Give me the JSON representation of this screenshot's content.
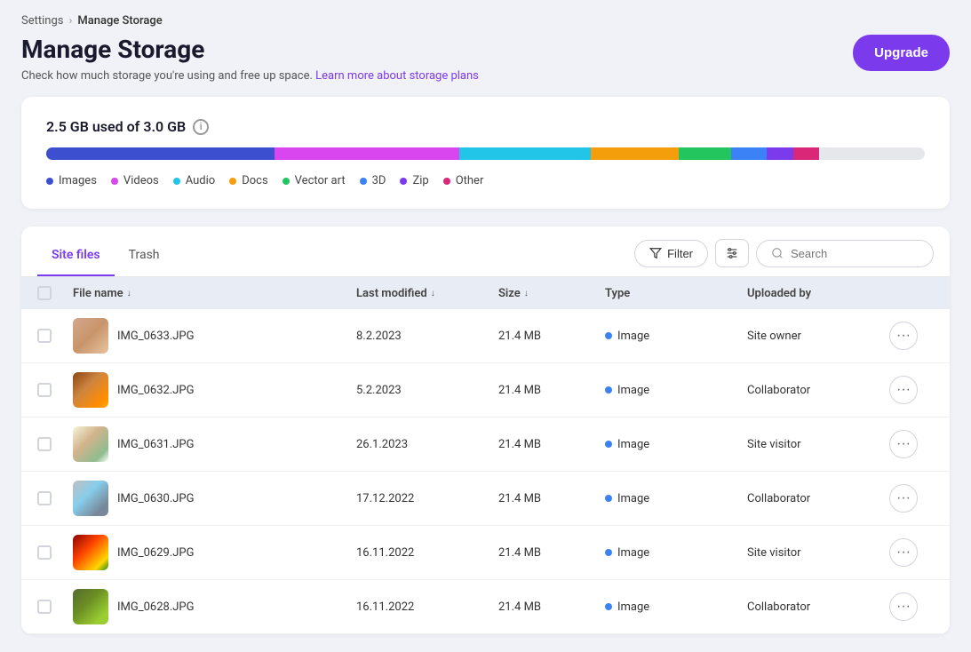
{
  "breadcrumb": {
    "parent": "Settings",
    "current": "Manage Storage"
  },
  "header": {
    "title": "Manage Storage",
    "subtitle": "Check how much storage you're using and free up space.",
    "link_text": "Learn more about storage plans",
    "upgrade_label": "Upgrade"
  },
  "storage": {
    "used_label": "2.5 GB used of 3.0 GB",
    "segments": [
      {
        "label": "Images",
        "color": "#3b4fcf",
        "width": "26%"
      },
      {
        "label": "Videos",
        "color": "#d946ef",
        "width": "21%"
      },
      {
        "label": "Audio",
        "color": "#22c4e8",
        "width": "15%"
      },
      {
        "label": "Docs",
        "color": "#f59e0b",
        "width": "10%"
      },
      {
        "label": "Vector art",
        "color": "#22c55e",
        "width": "6%"
      },
      {
        "label": "3D",
        "color": "#3b82f6",
        "width": "4%"
      },
      {
        "label": "Zip",
        "color": "#7c3aed",
        "width": "3%"
      },
      {
        "label": "Other",
        "color": "#db2777",
        "width": "3%"
      }
    ]
  },
  "tabs": [
    {
      "label": "Site files",
      "active": true
    },
    {
      "label": "Trash",
      "active": false
    }
  ],
  "toolbar": {
    "filter_label": "Filter",
    "search_placeholder": "Search"
  },
  "table": {
    "headers": [
      {
        "label": "File name",
        "sortable": true
      },
      {
        "label": "Last modified",
        "sortable": true
      },
      {
        "label": "Size",
        "sortable": true
      },
      {
        "label": "Type",
        "sortable": false
      },
      {
        "label": "Uploaded by",
        "sortable": false
      }
    ],
    "rows": [
      {
        "id": 1,
        "filename": "IMG_0633.JPG",
        "modified": "8.2.2023",
        "size": "21.4 MB",
        "type": "Image",
        "uploaded_by": "Site owner",
        "thumb_class": "thumb-1"
      },
      {
        "id": 2,
        "filename": "IMG_0632.JPG",
        "modified": "5.2.2023",
        "size": "21.4 MB",
        "type": "Image",
        "uploaded_by": "Collaborator",
        "thumb_class": "thumb-2"
      },
      {
        "id": 3,
        "filename": "IMG_0631.JPG",
        "modified": "26.1.2023",
        "size": "21.4 MB",
        "type": "Image",
        "uploaded_by": "Site visitor",
        "thumb_class": "thumb-3"
      },
      {
        "id": 4,
        "filename": "IMG_0630.JPG",
        "modified": "17.12.2022",
        "size": "21.4 MB",
        "type": "Image",
        "uploaded_by": "Collaborator",
        "thumb_class": "thumb-4"
      },
      {
        "id": 5,
        "filename": "IMG_0629.JPG",
        "modified": "16.11.2022",
        "size": "21.4 MB",
        "type": "Image",
        "uploaded_by": "Site visitor",
        "thumb_class": "thumb-5"
      },
      {
        "id": 6,
        "filename": "IMG_0628.JPG",
        "modified": "16.11.2022",
        "size": "21.4 MB",
        "type": "Image",
        "uploaded_by": "Collaborator",
        "thumb_class": "thumb-6"
      }
    ]
  }
}
